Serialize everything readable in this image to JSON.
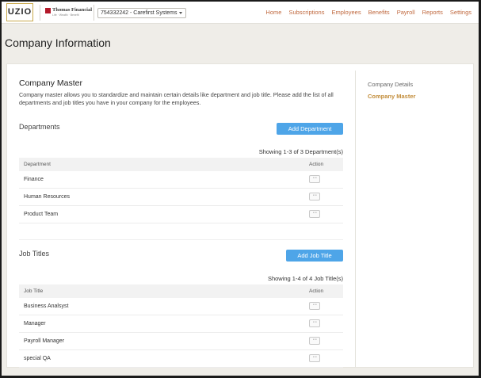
{
  "header": {
    "logo_text": "UZIO",
    "partner_name": "Thomas Financial",
    "partner_tagline": "Life · Wealth · Benefit",
    "company_selector": "754332242 - Carefirst Systems",
    "nav": [
      "Home",
      "Subscriptions",
      "Employees",
      "Benefits",
      "Payroll",
      "Reports",
      "Settings"
    ]
  },
  "page": {
    "title": "Company Information"
  },
  "sidebar": {
    "items": [
      "Company Details",
      "Company Master"
    ],
    "active_index": 1
  },
  "company_master": {
    "title": "Company Master",
    "description": "Company master allows you to standardize and maintain certain details like department and job title. Please add the list of all departments and job titles you have in your company for the employees."
  },
  "departments": {
    "title": "Departments",
    "add_label": "Add Department",
    "showing": "Showing 1-3 of 3 Department(s)",
    "col_name": "Department",
    "col_action": "Action",
    "rows": [
      "Finance",
      "Human Resources",
      "Product Team"
    ]
  },
  "job_titles": {
    "title": "Job Titles",
    "add_label": "Add Job Title",
    "showing": "Showing 1-4 of 4 Job Title(s)",
    "col_name": "Job Title",
    "col_action": "Action",
    "rows": [
      "Business Analsyst",
      "Manager",
      "Payroll Manager",
      "special QA"
    ]
  },
  "action_glyph": "···",
  "colors": {
    "accent": "#4ea5e8",
    "nav": "#c0693f",
    "active_link": "#c38e3c",
    "logo_border": "#c9a94b"
  }
}
